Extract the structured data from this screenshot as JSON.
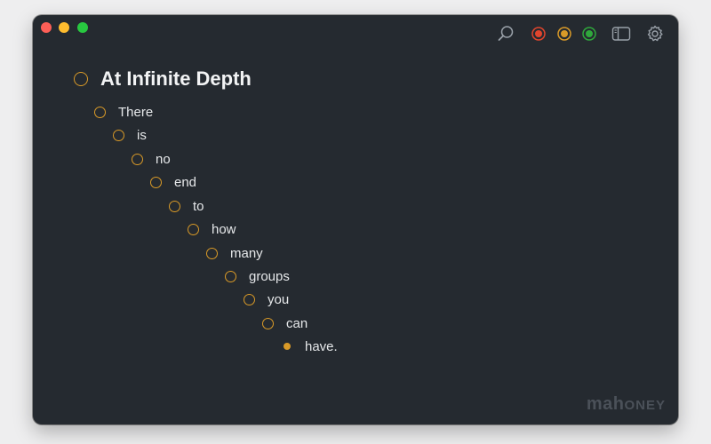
{
  "window": {
    "controls": [
      "close",
      "minimize",
      "maximize"
    ]
  },
  "toolbar": {
    "icons": [
      "search-icon",
      "red-filter-icon",
      "orange-filter-icon",
      "green-filter-icon",
      "sidebar-toggle-icon",
      "settings-gear-icon"
    ]
  },
  "colors": {
    "background": "#252a30",
    "bullet": "#d99a28",
    "text": "#e6e8ea",
    "red": "#e0452d",
    "orange": "#d99a28",
    "green": "#2fa83c"
  },
  "outline": {
    "title": "At Infinite Depth",
    "items": [
      "There",
      "is",
      "no",
      "end",
      "to",
      "how",
      "many",
      "groups",
      "you",
      "can",
      "have."
    ]
  },
  "watermark": {
    "main": "mah",
    "small": "ONEY"
  }
}
